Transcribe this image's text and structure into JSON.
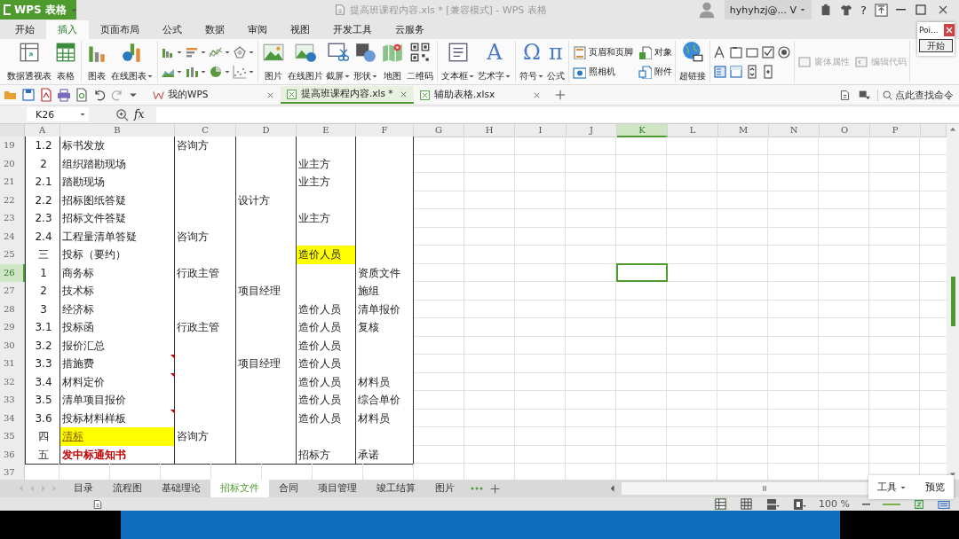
{
  "app_button": "WPS 表格",
  "title": "提高班课程内容.xls * [兼容模式] - WPS 表格",
  "user": "hyhyhzj@... V",
  "help": "?",
  "menu_tabs": [
    {
      "label": "开始",
      "selected": false
    },
    {
      "label": "插入",
      "selected": true
    },
    {
      "label": "页面布局",
      "selected": false
    },
    {
      "label": "公式",
      "selected": false
    },
    {
      "label": "数据",
      "selected": false
    },
    {
      "label": "审阅",
      "selected": false
    },
    {
      "label": "视图",
      "selected": false
    },
    {
      "label": "开发工具",
      "selected": false
    },
    {
      "label": "云服务",
      "selected": false
    }
  ],
  "ribbon_groups": [
    {
      "items": [
        {
          "kind": "large",
          "label": "数据透视表",
          "dropdown": false
        },
        {
          "kind": "large",
          "label": "表格",
          "dropdown": false
        }
      ]
    },
    {
      "items": [
        {
          "kind": "large",
          "label": "图表",
          "dropdown": false
        },
        {
          "kind": "large",
          "label": "在线图表",
          "dropdown": true
        }
      ]
    },
    {
      "items": [
        {
          "kind": "small",
          "dropdown": true
        },
        {
          "kind": "small",
          "dropdown": true
        },
        {
          "kind": "small",
          "dropdown": true
        },
        {
          "kind": "small",
          "dropdown": true
        },
        {
          "kind": "small",
          "dropdown": true
        },
        {
          "kind": "small",
          "dropdown": true
        },
        {
          "kind": "small",
          "dropdown": true
        },
        {
          "kind": "small",
          "dropdown": true
        }
      ]
    },
    {
      "items": [
        {
          "kind": "large",
          "label": "图片",
          "dropdown": false
        },
        {
          "kind": "large",
          "label": "在线图片",
          "dropdown": false
        },
        {
          "kind": "large",
          "label": "截屏",
          "dropdown": true
        },
        {
          "kind": "large",
          "label": "形状",
          "dropdown": true
        },
        {
          "kind": "large",
          "label": "地图",
          "dropdown": false
        },
        {
          "kind": "large",
          "label": "二维码",
          "dropdown": false
        }
      ]
    },
    {
      "items": [
        {
          "kind": "large",
          "label": "文本框",
          "dropdown": true
        },
        {
          "kind": "glyph",
          "glyph": "A",
          "label": "艺术字",
          "dropdown": true
        }
      ]
    },
    {
      "items": [
        {
          "kind": "glyph",
          "glyph": "Ω",
          "label": "符号",
          "dropdown": true
        },
        {
          "kind": "glyph",
          "glyph": "π",
          "label": "公式",
          "dropdown": false
        }
      ]
    },
    {
      "items": [
        {
          "kind": "row",
          "label": "页眉和页脚",
          "disabled": false
        },
        {
          "kind": "row",
          "label": "对象",
          "disabled": false
        },
        {
          "kind": "row",
          "label": "照相机",
          "disabled": false
        },
        {
          "kind": "row",
          "label": "附件",
          "disabled": false
        }
      ]
    },
    {
      "items": [
        {
          "kind": "large",
          "label": "超链接",
          "dropdown": false
        }
      ]
    },
    {
      "items": [
        {
          "kind": "small",
          "dropdown": false
        },
        {
          "kind": "small",
          "dropdown": false
        },
        {
          "kind": "small",
          "dropdown": false
        },
        {
          "kind": "small",
          "dropdown": false
        },
        {
          "kind": "small",
          "dropdown": false
        },
        {
          "kind": "small",
          "dropdown": false
        },
        {
          "kind": "small",
          "dropdown": false
        },
        {
          "kind": "small",
          "dropdown": false
        },
        {
          "kind": "small",
          "dropdown": false
        }
      ]
    },
    {
      "items": [
        {
          "kind": "row",
          "label": "窗体属性",
          "disabled": true
        },
        {
          "kind": "row",
          "label": "编辑代码",
          "disabled": true
        }
      ]
    }
  ],
  "doc_tabs": [
    {
      "label": "我的WPS",
      "selected": false
    },
    {
      "label": "提高班课程内容.xls *",
      "selected": true
    },
    {
      "label": "辅助表格.xlsx",
      "selected": false
    }
  ],
  "search": {
    "placeholder": "点此查找命令"
  },
  "name_box": "K26",
  "function_label": "fx",
  "columns": [
    {
      "label": "A",
      "selected": false
    },
    {
      "label": "B",
      "selected": false
    },
    {
      "label": "C",
      "selected": false
    },
    {
      "label": "D",
      "selected": false
    },
    {
      "label": "E",
      "selected": false
    },
    {
      "label": "F",
      "selected": false
    },
    {
      "label": "G",
      "selected": false
    },
    {
      "label": "H",
      "selected": false
    },
    {
      "label": "I",
      "selected": false
    },
    {
      "label": "J",
      "selected": false
    },
    {
      "label": "K",
      "selected": true
    },
    {
      "label": "L",
      "selected": false
    },
    {
      "label": "M",
      "selected": false
    },
    {
      "label": "N",
      "selected": false
    },
    {
      "label": "O",
      "selected": false
    },
    {
      "label": "P",
      "selected": false
    }
  ],
  "rows": [
    {
      "number": "19",
      "selected": false,
      "comment_mark": false,
      "cells": [
        {
          "text": "1.2"
        },
        {
          "text": "标书发放"
        },
        {
          "text": "咨询方"
        },
        {},
        {},
        {}
      ]
    },
    {
      "number": "20",
      "selected": false,
      "comment_mark": false,
      "cells": [
        {
          "text": "2"
        },
        {
          "text": "组织踏勘现场"
        },
        {},
        {},
        {
          "text": "业主方"
        },
        {}
      ]
    },
    {
      "number": "21",
      "selected": false,
      "comment_mark": false,
      "cells": [
        {
          "text": "2.1"
        },
        {
          "text": "踏勘现场"
        },
        {},
        {},
        {
          "text": "业主方"
        },
        {}
      ]
    },
    {
      "number": "22",
      "selected": false,
      "comment_mark": false,
      "cells": [
        {
          "text": "2.2"
        },
        {
          "text": "招标图纸答疑"
        },
        {},
        {
          "text": "设计方"
        },
        {},
        {}
      ]
    },
    {
      "number": "23",
      "selected": false,
      "comment_mark": false,
      "cells": [
        {
          "text": "2.3"
        },
        {
          "text": "招标文件答疑"
        },
        {},
        {},
        {
          "text": "业主方"
        },
        {}
      ]
    },
    {
      "number": "24",
      "selected": false,
      "comment_mark": false,
      "cells": [
        {
          "text": "2.4"
        },
        {
          "text": "工程量清单答疑"
        },
        {
          "text": "咨询方"
        },
        {},
        {},
        {}
      ]
    },
    {
      "number": "25",
      "selected": false,
      "comment_mark": false,
      "cells": [
        {
          "text": "三"
        },
        {
          "text": "投标（要约）"
        },
        {},
        {},
        {
          "text": "造价人员",
          "kind": "highlight"
        },
        {}
      ]
    },
    {
      "number": "26",
      "selected": true,
      "comment_mark": false,
      "cells": [
        {
          "text": "1"
        },
        {
          "text": "商务标"
        },
        {
          "text": "行政主管"
        },
        {},
        {},
        {
          "text": "资质文件"
        }
      ]
    },
    {
      "number": "27",
      "selected": false,
      "comment_mark": false,
      "cells": [
        {
          "text": "2"
        },
        {
          "text": "技术标"
        },
        {},
        {
          "text": "项目经理"
        },
        {},
        {
          "text": "施组"
        }
      ]
    },
    {
      "number": "28",
      "selected": false,
      "comment_mark": false,
      "cells": [
        {
          "text": "3"
        },
        {
          "text": "经济标"
        },
        {},
        {},
        {
          "text": "造价人员"
        },
        {
          "text": "清单报价"
        }
      ]
    },
    {
      "number": "29",
      "selected": false,
      "comment_mark": false,
      "cells": [
        {
          "text": "3.1"
        },
        {
          "text": "投标函"
        },
        {
          "text": "行政主管"
        },
        {},
        {
          "text": "造价人员"
        },
        {
          "text": "复核"
        }
      ]
    },
    {
      "number": "30",
      "selected": false,
      "comment_mark": false,
      "cells": [
        {
          "text": "3.2"
        },
        {
          "text": "报价汇总"
        },
        {},
        {},
        {
          "text": "造价人员"
        },
        {}
      ]
    },
    {
      "number": "31",
      "selected": false,
      "comment_mark": true,
      "cells": [
        {
          "text": "3.3"
        },
        {
          "text": "措施费"
        },
        {},
        {
          "text": "项目经理"
        },
        {
          "text": "造价人员"
        },
        {}
      ]
    },
    {
      "number": "32",
      "selected": false,
      "comment_mark": true,
      "cells": [
        {
          "text": "3.4"
        },
        {
          "text": "材料定价"
        },
        {},
        {},
        {
          "text": "造价人员"
        },
        {
          "text": "材料员"
        }
      ]
    },
    {
      "number": "33",
      "selected": false,
      "comment_mark": false,
      "cells": [
        {
          "text": "3.5"
        },
        {
          "text": "清单项目报价"
        },
        {},
        {},
        {
          "text": "造价人员"
        },
        {
          "text": "综合单价"
        }
      ]
    },
    {
      "number": "34",
      "selected": false,
      "comment_mark": true,
      "cells": [
        {
          "text": "3.6"
        },
        {
          "text": "投标材料样板"
        },
        {},
        {},
        {
          "text": "造价人员"
        },
        {
          "text": "材料员"
        }
      ]
    },
    {
      "number": "35",
      "selected": false,
      "comment_mark": false,
      "cells": [
        {
          "text": "四"
        },
        {
          "text": "清标",
          "kind": "link"
        },
        {
          "text": "咨询方"
        },
        {},
        {},
        {}
      ]
    },
    {
      "number": "36",
      "selected": false,
      "comment_mark": false,
      "cells": [
        {
          "text": "五"
        },
        {
          "text": "发中标通知书",
          "kind": "alert"
        },
        {},
        {},
        {
          "text": "招标方"
        },
        {
          "text": "承诺"
        }
      ]
    }
  ],
  "partial_row": "37",
  "sheet_tabs": [
    {
      "label": "目录",
      "selected": false
    },
    {
      "label": "流程图",
      "selected": false
    },
    {
      "label": "基础理论",
      "selected": false
    },
    {
      "label": "招标文件",
      "selected": true
    },
    {
      "label": "合同",
      "selected": false
    },
    {
      "label": "项目管理",
      "selected": false
    },
    {
      "label": "竣工结算",
      "selected": false
    },
    {
      "label": "图片",
      "selected": false
    }
  ],
  "zoom": "100 %",
  "popup": {
    "tools": "工具",
    "preview": "预览"
  },
  "mini_window": {
    "title": "Poi...",
    "button": "开始"
  }
}
